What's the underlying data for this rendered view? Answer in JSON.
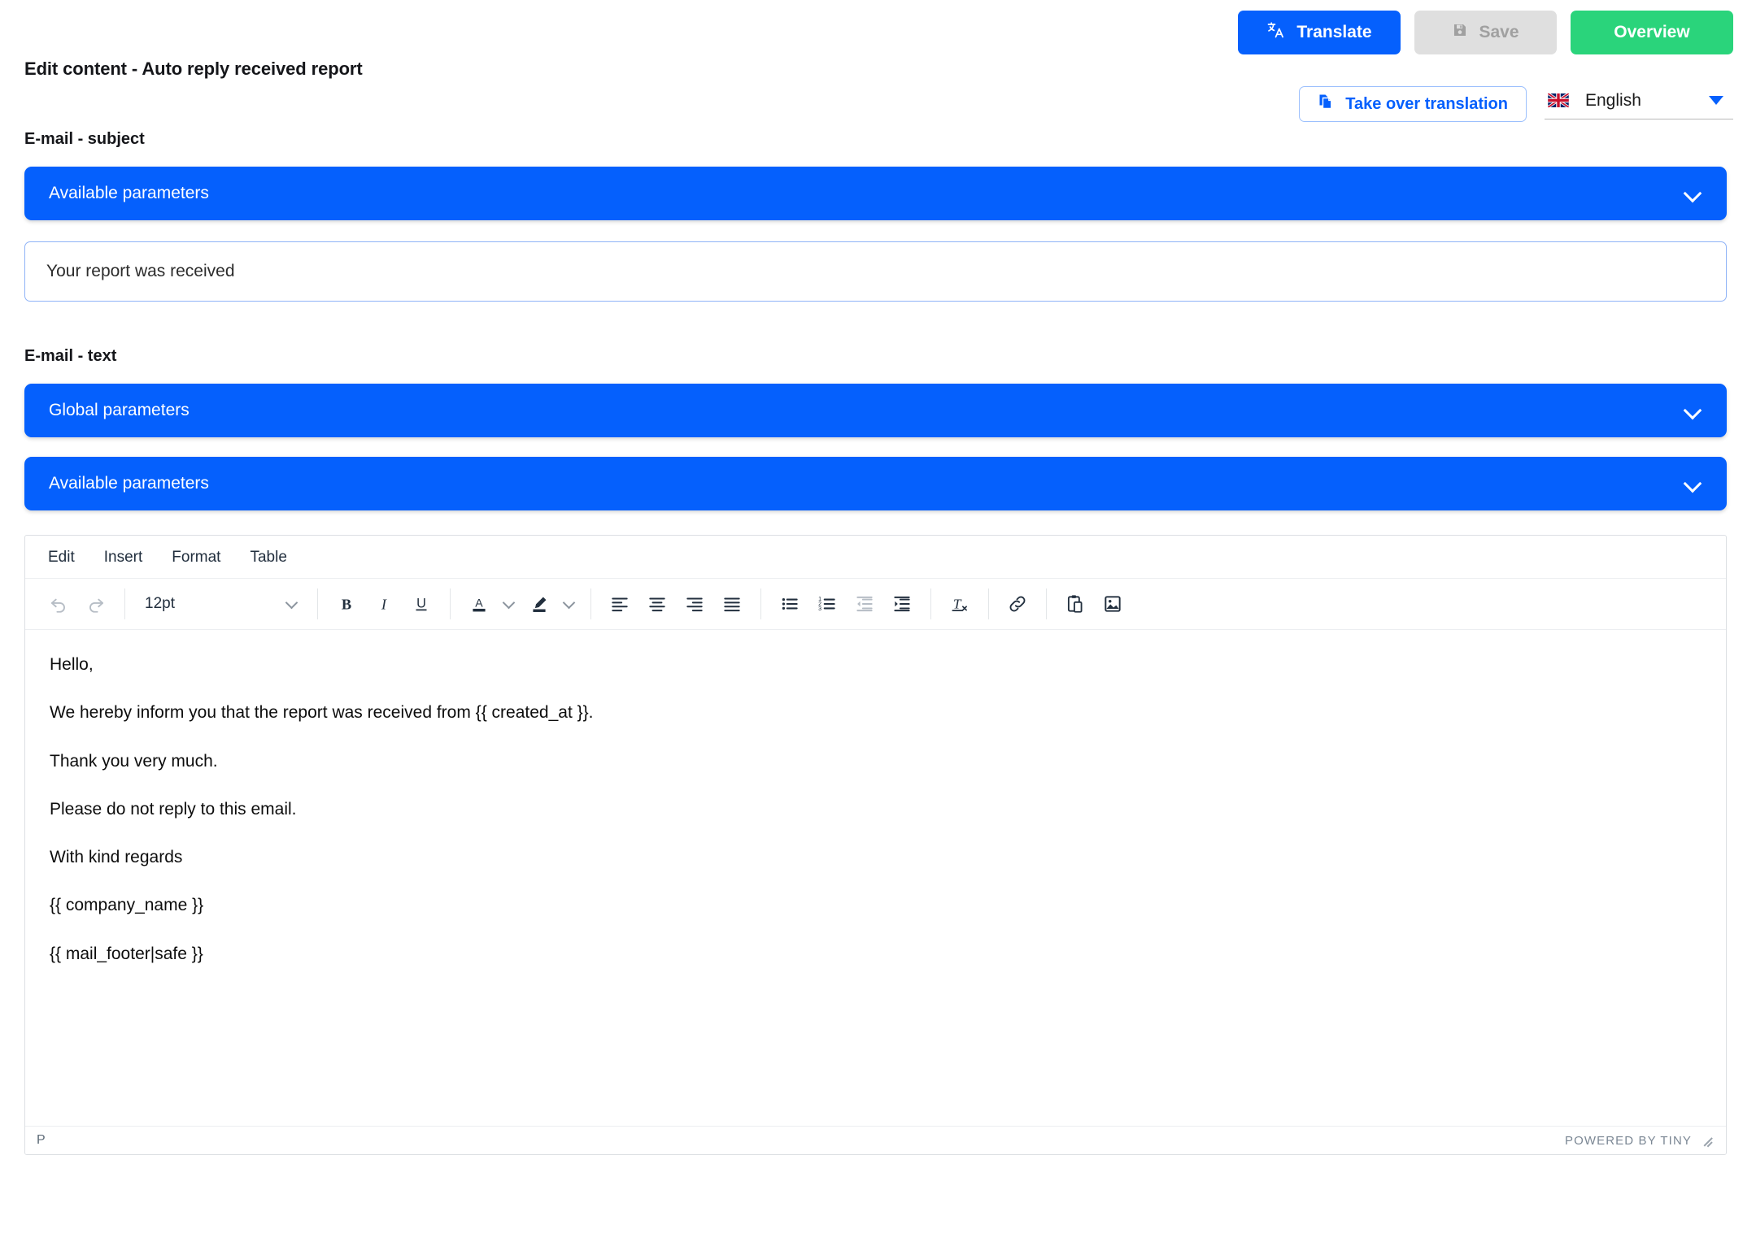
{
  "header": {
    "title": "Edit content - Auto reply received report",
    "buttons": {
      "translate": "Translate",
      "save": "Save",
      "overview": "Overview",
      "take_over_translation": "Take over translation"
    },
    "language": {
      "selected": "English",
      "flag": "uk-flag-icon"
    },
    "colors": {
      "primary_blue": "#0560fd",
      "green": "#2ad47b",
      "disabled_grey": "#dfdfdf"
    }
  },
  "sections": {
    "subject": {
      "label": "E-mail - subject",
      "accordion": "Available parameters",
      "input_value": "Your report was received",
      "input_placeholder": "Your report was received"
    },
    "text": {
      "label": "E-mail - text",
      "accordions": [
        "Global parameters",
        "Available parameters"
      ]
    }
  },
  "editor": {
    "menubar": [
      "Edit",
      "Insert",
      "Format",
      "Table"
    ],
    "fontsize": "12pt",
    "toolbar_icons": [
      "undo-icon",
      "redo-icon",
      "font-size-select",
      "bold-icon",
      "italic-icon",
      "underline-icon",
      "text-color-icon",
      "text-color-chevron-icon",
      "highlight-color-icon",
      "highlight-color-chevron-icon",
      "align-left-icon",
      "align-center-icon",
      "align-right-icon",
      "align-justify-icon",
      "bullet-list-icon",
      "numbered-list-icon",
      "outdent-icon",
      "indent-icon",
      "clear-formatting-icon",
      "link-icon",
      "paste-icon",
      "image-icon"
    ],
    "body": [
      "Hello,",
      "We hereby inform you that the report was received from {{ created_at }}.",
      "Thank you very much.",
      "Please do not reply to this email.",
      "With kind regards",
      "{{ company_name }}",
      "{{ mail_footer|safe }}"
    ],
    "status": {
      "path": "P",
      "branding": "POWERED BY TINY"
    }
  }
}
